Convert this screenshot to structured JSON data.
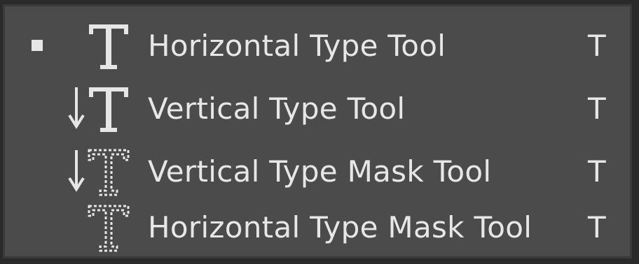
{
  "menu": {
    "items": [
      {
        "label": "Horizontal Type Tool",
        "shortcut": "T",
        "icon": "horizontal-type-icon",
        "active": true
      },
      {
        "label": "Vertical Type Tool",
        "shortcut": "T",
        "icon": "vertical-type-icon",
        "active": false
      },
      {
        "label": "Vertical Type Mask Tool",
        "shortcut": "T",
        "icon": "vertical-type-mask-icon",
        "active": false
      },
      {
        "label": "Horizontal Type Mask Tool",
        "shortcut": "T",
        "icon": "horizontal-type-mask-icon",
        "active": false
      }
    ]
  },
  "colors": {
    "panel": "#4b4b4b",
    "text": "#e7e7e7",
    "border": "#3a3a3a"
  }
}
